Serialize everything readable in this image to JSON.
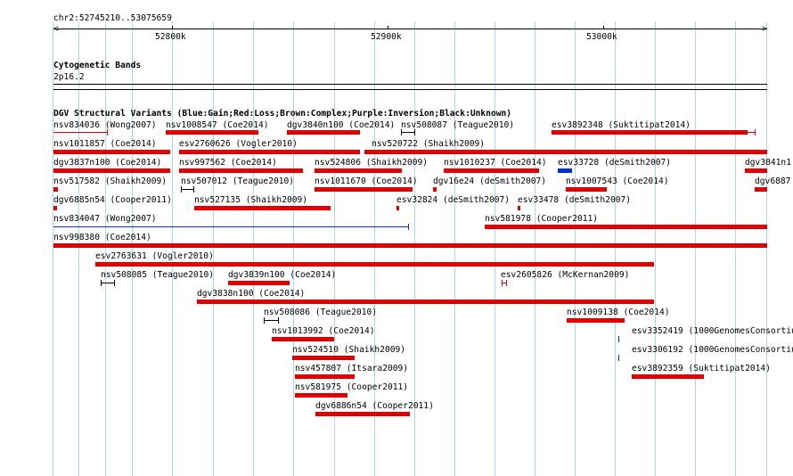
{
  "header": {
    "position": "chr2:52745210..53075659"
  },
  "ruler": {
    "ticks": [
      "52800k",
      "52900k",
      "53000k"
    ]
  },
  "cytoband": {
    "title": "Cytogenetic Bands",
    "band": "2p16.2"
  },
  "dgv": {
    "title": "DGV Structural Variants (Blue:Gain;Red:Loss;Brown:Complex;Purple:Inversion;Black:Unknown)",
    "legend_colors": {
      "gain": "#0033cc",
      "loss": "#e00000",
      "unknown": "#000000"
    },
    "features": [
      {
        "label": "nsv834036 (Wong2007)",
        "color": "#e00000",
        "type": "line"
      },
      {
        "label": "nsv1008547 (Coe2014)",
        "color": "#e00000",
        "type": "bar"
      },
      {
        "label": "dgv3840n100 (Coe2014)",
        "color": "#e00000",
        "type": "bar"
      },
      {
        "label": "nsv508087 (Teague2010)",
        "color": "#000000",
        "type": "line"
      },
      {
        "label": "esv3892348 (Suktitipat2014)",
        "color": "#e00000",
        "type": "bar"
      },
      {
        "label": "nsv1011857 (Coe2014)",
        "color": "#e00000",
        "type": "bar"
      },
      {
        "label": "esv2760626 (Vogler2010)",
        "color": "#e00000",
        "type": "bar"
      },
      {
        "label": "nsv520722 (Shaikh2009)",
        "color": "#e00000",
        "type": "bar"
      },
      {
        "label": "dgv3837n100 (Coe2014)",
        "color": "#e00000",
        "type": "bar"
      },
      {
        "label": "nsv997562 (Coe2014)",
        "color": "#e00000",
        "type": "bar"
      },
      {
        "label": "nsv524806 (Shaikh2009)",
        "color": "#e00000",
        "type": "bar"
      },
      {
        "label": "nsv1010237 (Coe2014)",
        "color": "#e00000",
        "type": "bar"
      },
      {
        "label": "esv33728 (deSmith2007)",
        "color": "#0033cc",
        "type": "bar"
      },
      {
        "label": "dgv3841n1",
        "color": "#e00000",
        "type": "bar"
      },
      {
        "label": "nsv517582 (Shaikh2009)",
        "color": "#e00000",
        "type": "bar"
      },
      {
        "label": "nsv507012 (Teague2010)",
        "color": "#000000",
        "type": "line"
      },
      {
        "label": "nsv1011670 (Coe2014)",
        "color": "#e00000",
        "type": "bar"
      },
      {
        "label": "dgv16e24 (deSmith2007)",
        "color": "#e00000",
        "type": "bar"
      },
      {
        "label": "nsv1007543 (Coe2014)",
        "color": "#e00000",
        "type": "bar"
      },
      {
        "label": "dgv6887",
        "color": "#e00000",
        "type": "bar"
      },
      {
        "label": "dgv6885n54 (Cooper2011)",
        "color": "#e00000",
        "type": "bar"
      },
      {
        "label": "nsv527135 (Shaikh2009)",
        "color": "#e00000",
        "type": "bar"
      },
      {
        "label": "esv32824 (deSmith2007)",
        "color": "#e00000",
        "type": "bar"
      },
      {
        "label": "esv33478 (deSmith2007)",
        "color": "#e00000",
        "type": "bar"
      },
      {
        "label": "nsv834047 (Wong2007)",
        "color": "#0033cc",
        "type": "line"
      },
      {
        "label": "nsv581978 (Cooper2011)",
        "color": "#e00000",
        "type": "bar"
      },
      {
        "label": "nsv998380 (Coe2014)",
        "color": "#e00000",
        "type": "bar"
      },
      {
        "label": "esv2763631 (Vogler2010)",
        "color": "#e00000",
        "type": "bar"
      },
      {
        "label": "nsv508085 (Teague2010)",
        "color": "#000000",
        "type": "line"
      },
      {
        "label": "dgv3839n100 (Coe2014)",
        "color": "#e00000",
        "type": "bar"
      },
      {
        "label": "esv2605826 (McKernan2009)",
        "color": "#e00000",
        "type": "line"
      },
      {
        "label": "dgv3838n100 (Coe2014)",
        "color": "#e00000",
        "type": "bar"
      },
      {
        "label": "nsv508086 (Teague2010)",
        "color": "#000000",
        "type": "line"
      },
      {
        "label": "nsv1009138 (Coe2014)",
        "color": "#e00000",
        "type": "bar"
      },
      {
        "label": "nsv1013992 (Coe2014)",
        "color": "#e00000",
        "type": "bar"
      },
      {
        "label": "esv3352419 (1000GenomesConsortium",
        "color": "#0033cc",
        "type": "bar"
      },
      {
        "label": "nsv524510 (Shaikh2009)",
        "color": "#e00000",
        "type": "bar"
      },
      {
        "label": "esv3306192 (1000GenomesConsortium",
        "color": "#0033cc",
        "type": "bar"
      },
      {
        "label": "nsv457807 (Itsara2009)",
        "color": "#e00000",
        "type": "bar"
      },
      {
        "label": "esv3892359 (Suktitipat2014)",
        "color": "#e00000",
        "type": "bar"
      },
      {
        "label": "nsv581975 (Cooper2011)",
        "color": "#e00000",
        "type": "bar"
      },
      {
        "label": "dgv6886n54 (Cooper2011)",
        "color": "#e00000",
        "type": "bar"
      }
    ]
  }
}
